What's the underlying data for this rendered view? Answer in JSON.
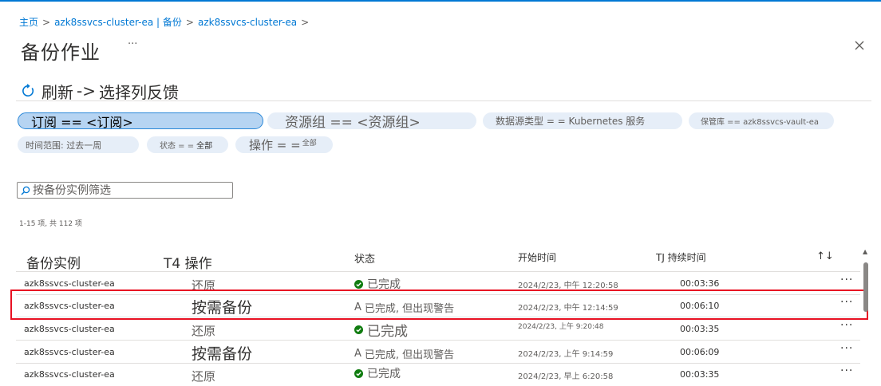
{
  "breadcrumb": {
    "home": "主页",
    "sep": ">",
    "cluster": "azk8ssvcs-cluster-ea |",
    "backup": "备份",
    "cluster2": "azk8ssvcs-cluster-ea"
  },
  "page": {
    "title": "备份作业",
    "more": "···"
  },
  "toolbar": {
    "refresh": "刷新",
    "arrow": "->",
    "choose_columns": "选择列",
    "feedback": "反馈"
  },
  "filters": {
    "subscription": "订阅 == <订阅>",
    "resource_group": "资源组 == <资源组>",
    "datasource_type": "数据源类型 =  = Kubernetes 服务",
    "vault": "保管库 == azk8ssvcs-vault-ea",
    "time_range": "时间范围:  过去一周",
    "status_label": "状态 =  =",
    "status_value": "全部",
    "operation_label": "操作 =  =",
    "operation_value": "全部"
  },
  "search": {
    "placeholder": "按备份实例筛选"
  },
  "count": "1-15 项, 共 112 项",
  "table": {
    "columns": {
      "instance": "备份实例",
      "operation": "T4 操作",
      "status": "状态",
      "start": "开始时间",
      "duration": "TJ 持续时间",
      "sort": "↑↓"
    },
    "rows": [
      {
        "instance": "azk8ssvcs-cluster-ea",
        "operation": "还原",
        "status": "已完成",
        "start": "2024/2/23, 中午 12:20:58",
        "duration": "00:03:36",
        "more": "···"
      },
      {
        "instance": "azk8ssvcs-cluster-ea",
        "operation": "按需备份",
        "status_prefix": "A",
        "status": "已完成, 但出现警告",
        "start": "2024/2/23, 中午 12:14:59",
        "duration": "00:06:10",
        "more": "···"
      },
      {
        "instance": "azk8ssvcs-cluster-ea",
        "operation": "还原",
        "status": "已完成",
        "start": "2024/2/23, 上午 9:20:48",
        "duration": "00:03:35",
        "more": "···"
      },
      {
        "instance": "azk8ssvcs-cluster-ea",
        "operation": "按需备份",
        "status_prefix": "A",
        "status": "已完成, 但出现警告",
        "start": "2024/2/23, 上午 9:14:59",
        "duration": "00:06:09",
        "more": "···"
      },
      {
        "instance": "azk8ssvcs-cluster-ea",
        "operation": "还原",
        "status": "已完成",
        "start": "2024/2/23, 早上 6:20:58",
        "duration": "00:03:35",
        "more": "···"
      }
    ]
  },
  "colors": {
    "accent": "#0078d4",
    "success": "#107c10",
    "highlight": "#e81123",
    "pill": "#e6eef8"
  },
  "icons": {
    "refresh": "refresh-icon",
    "close": "close-icon",
    "search": "search-icon",
    "success": "success-check-icon",
    "scroll_up": "chevron-up-icon"
  }
}
